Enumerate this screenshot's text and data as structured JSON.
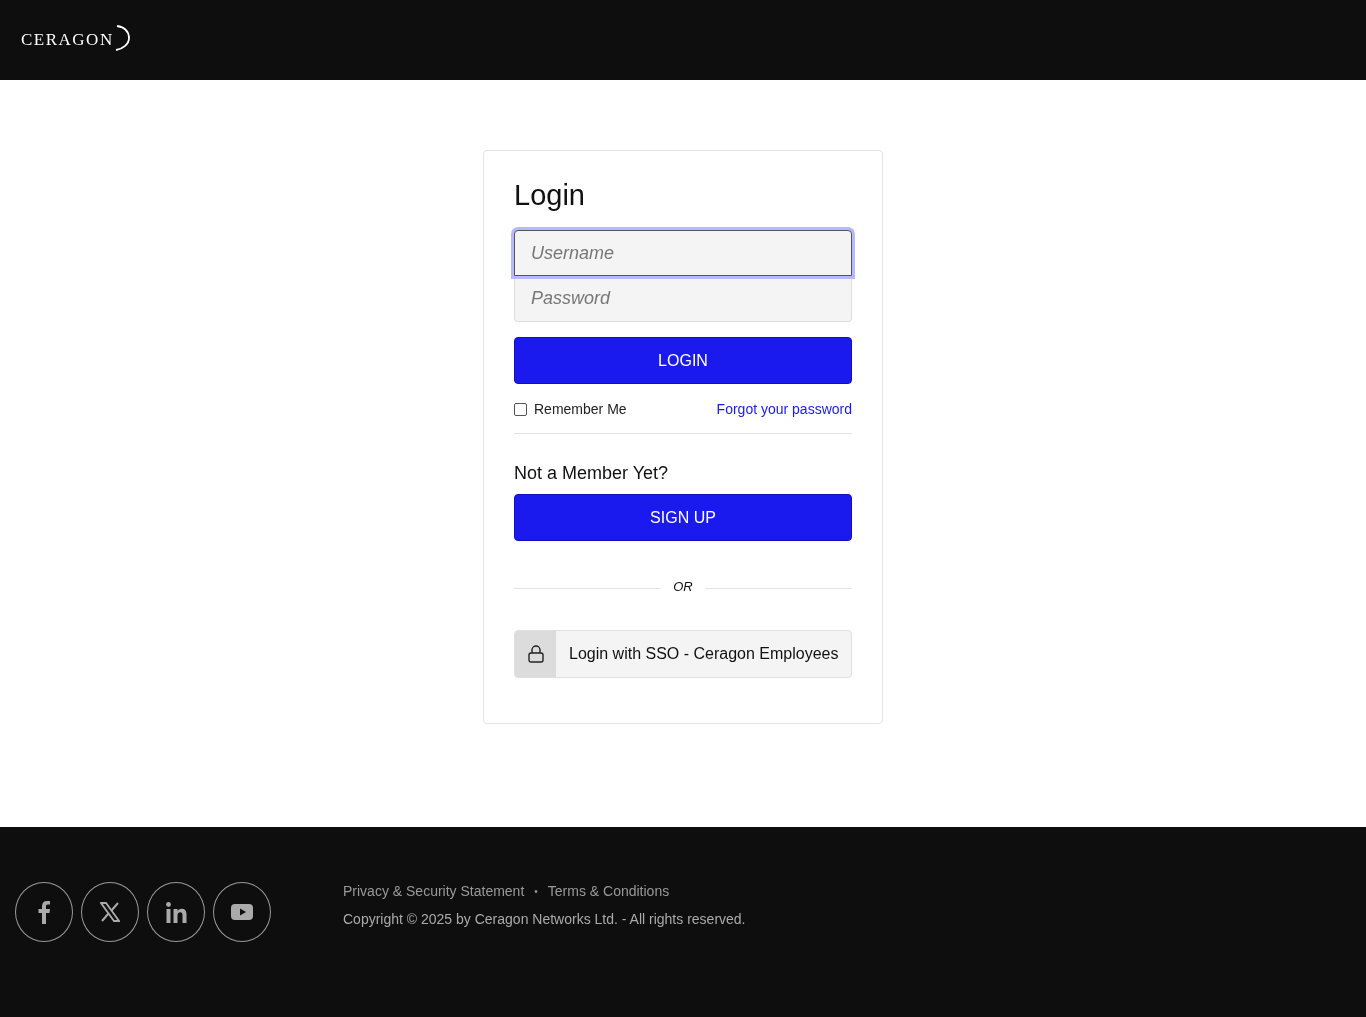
{
  "header": {
    "logo": "CERAGON"
  },
  "login": {
    "title": "Login",
    "fields": [
      {
        "placeholder": "Username",
        "focused": true
      },
      {
        "placeholder": "Password",
        "focused": false
      }
    ],
    "login_button": "LOGIN",
    "remember": {
      "label": "Remember Me",
      "checked": false
    },
    "forgot_link": "Forgot your password",
    "signup_heading": "Not a Member Yet?",
    "signup_button": "SIGN UP",
    "divider": "OR",
    "sso_button": "Login with SSO - Ceragon Employees"
  },
  "footer": {
    "social": [
      {
        "kind": "facebook"
      },
      {
        "kind": "x"
      },
      {
        "kind": "linkedin"
      },
      {
        "kind": "youtube"
      }
    ],
    "links": [
      "Privacy & Security Statement",
      "Terms & Conditions"
    ],
    "separator": "•",
    "copyright": "Copyright © 2025 by Ceragon Networks Ltd. - All rights reserved."
  }
}
